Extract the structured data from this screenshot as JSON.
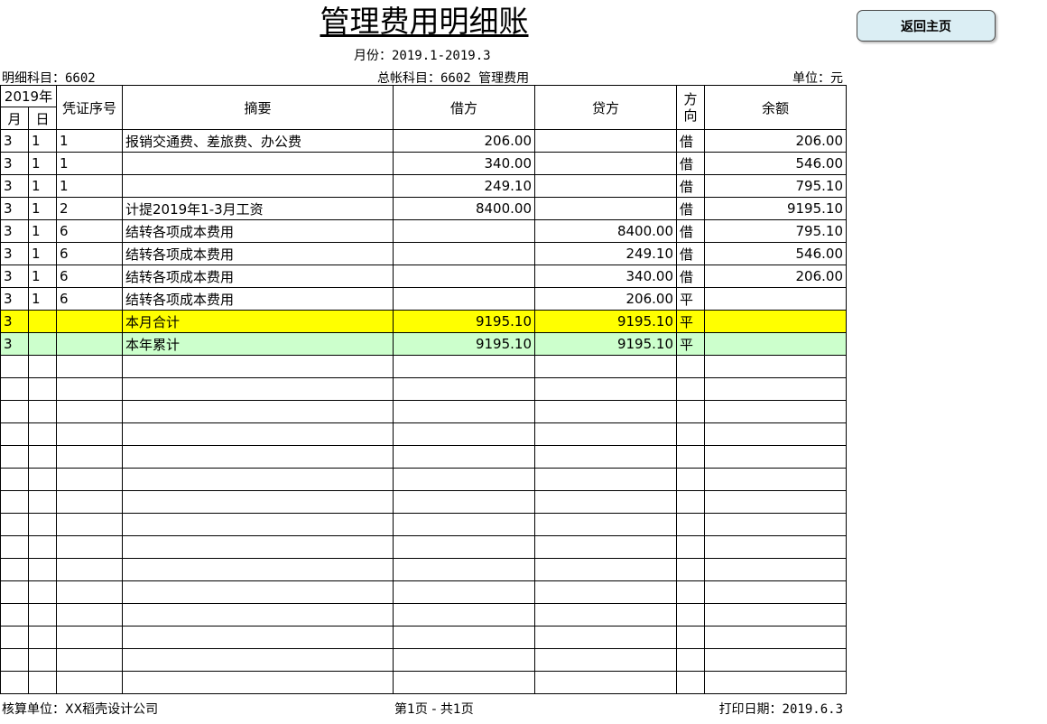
{
  "title": "管理费用明细账",
  "period": "月份：2019.1-2019.3",
  "detail_account": "明细科目：6602",
  "general_account": "总帐科目：6602  管理费用",
  "unit": "单位：元",
  "return_button": "返回主页",
  "columns": {
    "year": "2019年",
    "month": "月",
    "day": "日",
    "voucher": "凭证序号",
    "summary": "摘要",
    "debit": "借方",
    "credit": "贷方",
    "direction": "方向",
    "balance": "余额"
  },
  "rows": [
    {
      "m": "3",
      "d": "1",
      "v": "1",
      "summary": "报销交通费、差旅费、办公费",
      "debit": "206.00",
      "credit": "",
      "dir": "借",
      "balance": "206.00"
    },
    {
      "m": "3",
      "d": "1",
      "v": "1",
      "summary": "",
      "debit": "340.00",
      "credit": "",
      "dir": "借",
      "balance": "546.00"
    },
    {
      "m": "3",
      "d": "1",
      "v": "1",
      "summary": "",
      "debit": "249.10",
      "credit": "",
      "dir": "借",
      "balance": "795.10"
    },
    {
      "m": "3",
      "d": "1",
      "v": "2",
      "summary": "计提2019年1-3月工资",
      "debit": "8400.00",
      "credit": "",
      "dir": "借",
      "balance": "9195.10"
    },
    {
      "m": "3",
      "d": "1",
      "v": "6",
      "summary": "结转各项成本费用",
      "debit": "",
      "credit": "8400.00",
      "dir": "借",
      "balance": "795.10"
    },
    {
      "m": "3",
      "d": "1",
      "v": "6",
      "summary": "结转各项成本费用",
      "debit": "",
      "credit": "249.10",
      "dir": "借",
      "balance": "546.00"
    },
    {
      "m": "3",
      "d": "1",
      "v": "6",
      "summary": "结转各项成本费用",
      "debit": "",
      "credit": "340.00",
      "dir": "借",
      "balance": "206.00"
    },
    {
      "m": "3",
      "d": "1",
      "v": "6",
      "summary": "结转各项成本费用",
      "debit": "",
      "credit": "206.00",
      "dir": "平",
      "balance": ""
    }
  ],
  "month_total": {
    "m": "3",
    "summary": "本月合计",
    "debit": "9195.10",
    "credit": "9195.10",
    "dir": "平"
  },
  "year_total": {
    "m": "3",
    "summary": "本年累计",
    "debit": "9195.10",
    "credit": "9195.10",
    "dir": "平"
  },
  "footer": {
    "company": "核算单位：XX稻壳设计公司",
    "page": "第1页 - 共1页",
    "print_date": "打印日期：2019.6.3"
  }
}
